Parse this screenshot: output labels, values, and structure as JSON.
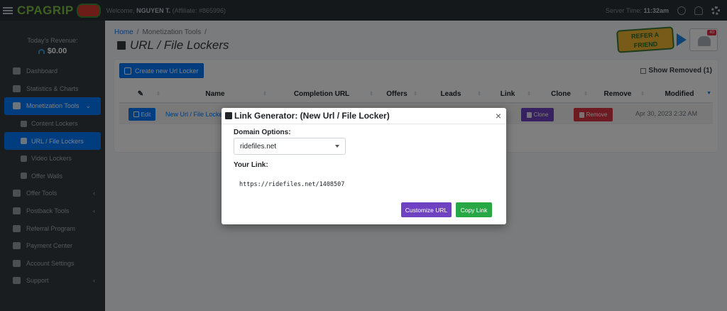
{
  "topbar": {
    "logo": "CPAGRIP",
    "logo_badge": "",
    "welcome_prefix": "Welcome,",
    "user_name": "NGUYEN T.",
    "affiliate": "(Affiliate: #865996)",
    "server_time_label": "Server Time:",
    "server_time": "11:32am"
  },
  "sidebar": {
    "revenue_label": "Today's Revenue:",
    "revenue_value": "$0.00",
    "items": [
      {
        "label": "Dashboard",
        "icon": "dashboard-icon"
      },
      {
        "label": "Statistics & Charts",
        "icon": "chart-icon"
      },
      {
        "label": "Monetization Tools",
        "icon": "tools-icon"
      },
      {
        "label": "Content Lockers",
        "icon": "lock-icon"
      },
      {
        "label": "URL / File Lockers",
        "icon": "file-lock-icon"
      },
      {
        "label": "Video Lockers",
        "icon": "video-icon"
      },
      {
        "label": "Offer Walls",
        "icon": "list-icon"
      },
      {
        "label": "Offer Tools",
        "icon": "briefcase-icon"
      },
      {
        "label": "Postback Tools",
        "icon": "cloud-icon"
      },
      {
        "label": "Referral Program",
        "icon": "handshake-icon"
      },
      {
        "label": "Payment Center",
        "icon": "money-icon"
      },
      {
        "label": "Account Settings",
        "icon": "gear-icon"
      },
      {
        "label": "Support",
        "icon": "info-icon"
      }
    ]
  },
  "breadcrumb": {
    "home": "Home",
    "section": "Monetization Tools",
    "sep": "/"
  },
  "page_title": "URL / File Lockers",
  "promo": {
    "refer_line1": "REFER A",
    "refer_line2": "FRIEND",
    "badge": "40"
  },
  "toolbar": {
    "create_label": "Create new Url Locker",
    "show_removed": "Show Removed (1)"
  },
  "table": {
    "headers": [
      "",
      "Name",
      "Completion URL",
      "Offers",
      "Leads",
      "Link",
      "Clone",
      "Remove",
      "Modified"
    ],
    "row": {
      "edit": "Edit",
      "name": "New Url / File Locker",
      "clone": "Clone",
      "remove": "Remove",
      "modified": "Apr 30, 2023 2:32 AM"
    }
  },
  "modal": {
    "title": "Link Generator: (New Url / File Locker)",
    "close": "×",
    "domain_label": "Domain Options:",
    "domain_value": "ridefiles.net",
    "link_label": "Your Link:",
    "link_value": "https://ridefiles.net/1408507",
    "customize_label": "Customize URL",
    "copy_label": "Copy Link"
  },
  "colors": {
    "primary": "#007bff",
    "purple": "#6f42c1",
    "danger": "#dc3545",
    "success": "#28a745",
    "sidebar": "#343a40"
  }
}
